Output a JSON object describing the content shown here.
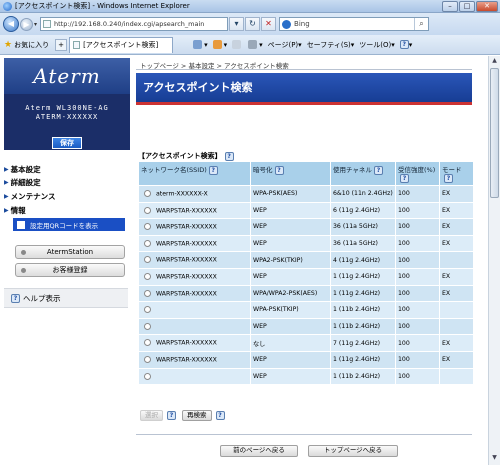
{
  "window": {
    "title": "[アクセスポイント検索] - Windows Internet Explorer",
    "min": "–",
    "max": "□",
    "close": "✕"
  },
  "address": {
    "url": "http://192.168.0.240/index.cgi/apsearch_main",
    "search_placeholder": "Bing"
  },
  "tabbar": {
    "favorites": "お気に入り",
    "tab_title": "[アクセスポイント検索]",
    "page_menu": "ページ(P)",
    "safety_menu": "セーフティ(S)",
    "tools_menu": "ツール(O)",
    "help_glyph": "?"
  },
  "sidebar": {
    "logo": "Aterm",
    "model_line1": "Aterm WL300NE-AG",
    "model_line2": "ATERM-XXXXXX",
    "save": "保存",
    "nav": [
      "基本設定",
      "詳細設定",
      "メンテナンス",
      "情報"
    ],
    "qr_button": "設定用QRコードを表示",
    "aterm_station": "AtermStation",
    "customer_reg": "お客様登録",
    "help": "ヘルプ表示"
  },
  "main": {
    "breadcrumb": "トップページ > 基本設定 > アクセスポイント検索",
    "page_title": "アクセスポイント検索",
    "section_title": "【アクセスポイント検索】",
    "columns": [
      "ネットワーク名(SSID)",
      "暗号化",
      "使用チャネル",
      "受信強度(%)",
      "モード"
    ],
    "rows": [
      {
        "ssid": "aterm-XXXXXX-X",
        "enc": "WPA-PSK(AES)",
        "ch": "6&10 (11n 2.4GHz)",
        "sig": "100",
        "mode": "EX"
      },
      {
        "ssid": "WARPSTAR-XXXXXX",
        "enc": "WEP",
        "ch": "6 (11g 2.4GHz)",
        "sig": "100",
        "mode": "EX"
      },
      {
        "ssid": "WARPSTAR-XXXXXX",
        "enc": "WEP",
        "ch": "36 (11a 5GHz)",
        "sig": "100",
        "mode": "EX"
      },
      {
        "ssid": "WARPSTAR-XXXXXX",
        "enc": "WEP",
        "ch": "36 (11a 5GHz)",
        "sig": "100",
        "mode": "EX"
      },
      {
        "ssid": "WARPSTAR-XXXXXX",
        "enc": "WPA2-PSK(TKIP)",
        "ch": "4 (11g 2.4GHz)",
        "sig": "100",
        "mode": ""
      },
      {
        "ssid": "WARPSTAR-XXXXXX",
        "enc": "WEP",
        "ch": "1 (11g 2.4GHz)",
        "sig": "100",
        "mode": "EX"
      },
      {
        "ssid": "WARPSTAR-XXXXXX",
        "enc": "WPA/WPA2-PSK(AES)",
        "ch": "1 (11g 2.4GHz)",
        "sig": "100",
        "mode": "EX"
      },
      {
        "ssid": "",
        "enc": "WPA-PSK(TKIP)",
        "ch": "1 (11b 2.4GHz)",
        "sig": "100",
        "mode": ""
      },
      {
        "ssid": "",
        "enc": "WEP",
        "ch": "1 (11b 2.4GHz)",
        "sig": "100",
        "mode": ""
      },
      {
        "ssid": "WARPSTAR-XXXXXX",
        "enc": "なし",
        "ch": "7 (11g 2.4GHz)",
        "sig": "100",
        "mode": "EX"
      },
      {
        "ssid": "WARPSTAR-XXXXXX",
        "enc": "WEP",
        "ch": "1 (11g 2.4GHz)",
        "sig": "100",
        "mode": "EX"
      },
      {
        "ssid": "",
        "enc": "WEP",
        "ch": "1 (11b 2.4GHz)",
        "sig": "100",
        "mode": ""
      }
    ],
    "select_button": "選択",
    "research_button": "再検索",
    "prev_button": "前のページへ戻る",
    "top_button": "トップページへ戻る"
  },
  "colors": {
    "header_blue": "#1f48a8",
    "table_header": "#a9d0ea",
    "table_cell": "#cfe4f3",
    "sidebar_dark": "#1b2e68"
  }
}
